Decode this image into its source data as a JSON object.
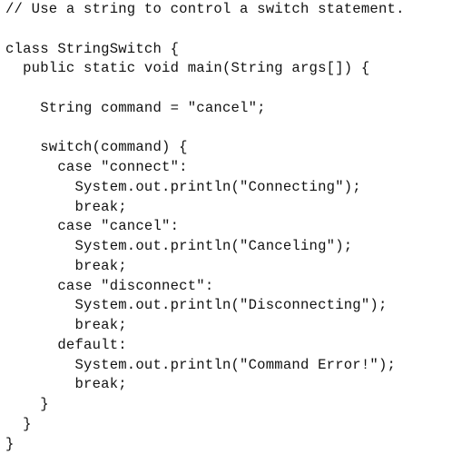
{
  "code": {
    "lines": [
      "// Use a string to control a switch statement.",
      "",
      "class StringSwitch {",
      "  public static void main(String args[]) {",
      "",
      "    String command = \"cancel\";",
      "",
      "    switch(command) {",
      "      case \"connect\":",
      "        System.out.println(\"Connecting\");",
      "        break;",
      "      case \"cancel\":",
      "        System.out.println(\"Canceling\");",
      "        break;",
      "      case \"disconnect\":",
      "        System.out.println(\"Disconnecting\");",
      "        break;",
      "      default:",
      "        System.out.println(\"Command Error!\");",
      "        break;",
      "    }",
      "  }",
      "}"
    ]
  }
}
